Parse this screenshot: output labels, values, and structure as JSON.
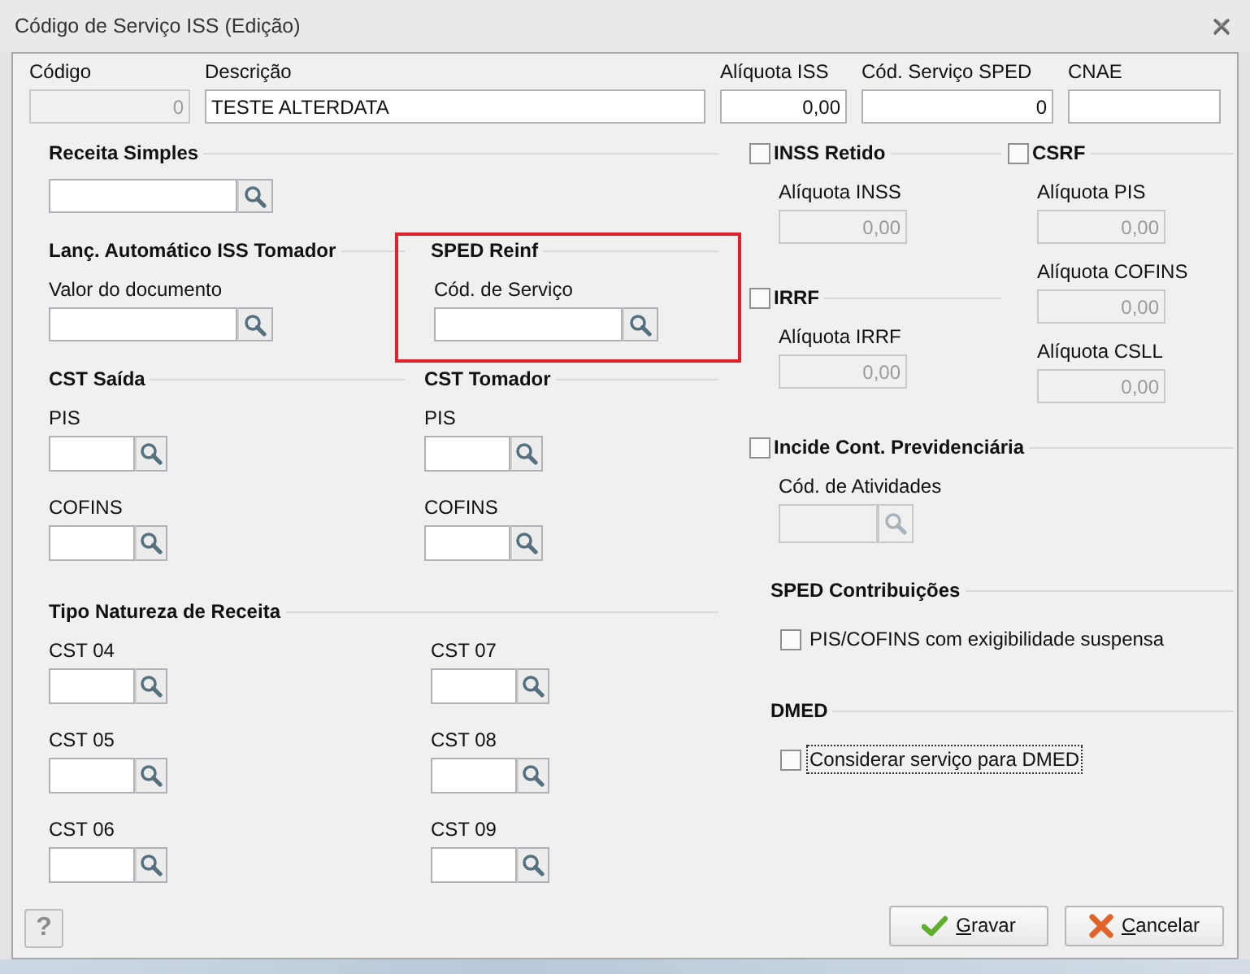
{
  "window": {
    "title": "Código de Serviço ISS (Edição)"
  },
  "top_fields": [
    {
      "label": "Código",
      "kind": "number",
      "value": "0",
      "disabled": true
    },
    {
      "label": "Descrição",
      "kind": "text",
      "value": "TESTE ALTERDATA",
      "disabled": false
    },
    {
      "label": "Alíquota ISS",
      "kind": "number",
      "value": "0,00",
      "disabled": false
    },
    {
      "label": "Cód. Serviço SPED",
      "kind": "number",
      "value": "0",
      "disabled": false
    },
    {
      "label": "CNAE",
      "kind": "text",
      "disabled": false
    }
  ],
  "receita_simples": {
    "title": "Receita Simples",
    "fields": [
      {
        "kind": "lookup",
        "disabled": false
      }
    ]
  },
  "lanc_automatico": {
    "title": "Lanç. Automático ISS Tomador",
    "fields": [
      {
        "label": "Valor do documento",
        "kind": "lookup",
        "disabled": false
      }
    ]
  },
  "sped_reinf": {
    "title": "SPED Reinf",
    "highlighted": true,
    "fields": [
      {
        "label": "Cód. de Serviço",
        "kind": "lookup",
        "disabled": false
      }
    ]
  },
  "cst_saida": {
    "title": "CST Saída",
    "fields": [
      {
        "label": "PIS",
        "kind": "lookup",
        "disabled": false
      },
      {
        "label": "COFINS",
        "kind": "lookup",
        "disabled": false
      }
    ]
  },
  "cst_tomador": {
    "title": "CST Tomador",
    "fields": [
      {
        "label": "PIS",
        "kind": "lookup",
        "disabled": false
      },
      {
        "label": "COFINS",
        "kind": "lookup",
        "disabled": false
      }
    ]
  },
  "tipo_natureza": {
    "title": "Tipo Natureza de Receita",
    "fields": [
      {
        "label": "CST 04",
        "kind": "lookup",
        "disabled": false
      },
      {
        "label": "CST 05",
        "kind": "lookup",
        "disabled": false
      },
      {
        "label": "CST 06",
        "kind": "lookup",
        "disabled": false
      },
      {
        "label": "CST 07",
        "kind": "lookup",
        "disabled": false
      },
      {
        "label": "CST 08",
        "kind": "lookup",
        "disabled": false
      },
      {
        "label": "CST 09",
        "kind": "lookup",
        "disabled": false
      }
    ]
  },
  "inss_retido": {
    "title": "INSS Retido",
    "checked": false,
    "fields": [
      {
        "label": "Alíquota INSS",
        "kind": "number",
        "value": "0,00",
        "disabled": true
      }
    ]
  },
  "csrf": {
    "title": "CSRF",
    "checked": false,
    "fields": [
      {
        "label": "Alíquota PIS",
        "kind": "number",
        "value": "0,00",
        "disabled": true
      },
      {
        "label": "Alíquota COFINS",
        "kind": "number",
        "value": "0,00",
        "disabled": true
      },
      {
        "label": "Alíquota CSLL",
        "kind": "number",
        "value": "0,00",
        "disabled": true
      }
    ]
  },
  "irrf": {
    "title": "IRRF",
    "checked": false,
    "fields": [
      {
        "label": "Alíquota IRRF",
        "kind": "number",
        "value": "0,00",
        "disabled": true
      }
    ]
  },
  "incide_previdenciaria": {
    "title": "Incide Cont. Previdenciária",
    "checked": false,
    "fields": [
      {
        "label": "Cód. de Atividades",
        "kind": "lookup",
        "disabled": true
      }
    ]
  },
  "sped_contribuicoes": {
    "title": "SPED Contribuições",
    "options": [
      {
        "label": "PIS/COFINS com exigibilidade suspensa",
        "checked": false,
        "focused": false
      }
    ]
  },
  "dmed": {
    "title": "DMED",
    "options": [
      {
        "label": "Considerar serviço para DMED",
        "checked": false,
        "focused": true
      }
    ]
  },
  "buttons": [
    {
      "kind": "help",
      "label": "?"
    },
    {
      "kind": "save",
      "label": "Gravar"
    },
    {
      "kind": "cancel",
      "label": "Cancelar"
    }
  ]
}
